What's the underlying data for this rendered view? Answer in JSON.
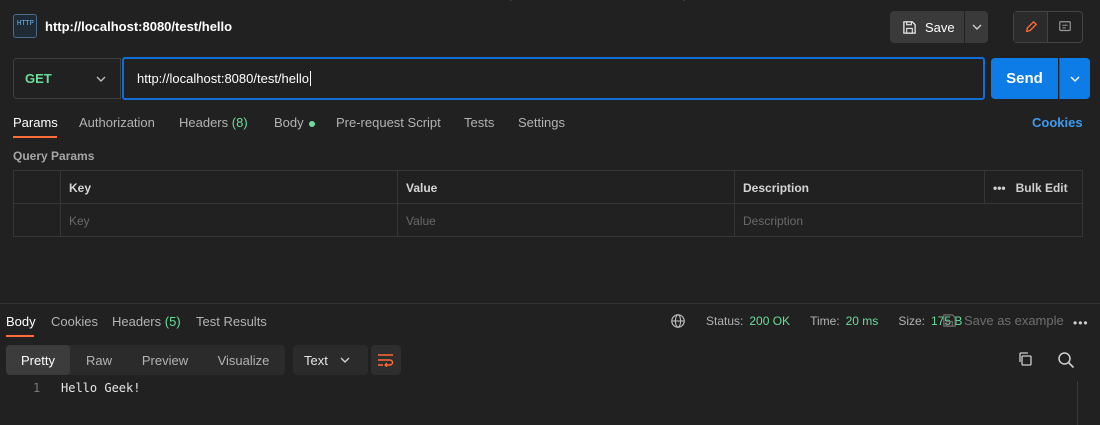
{
  "header": {
    "icon_label": "HTTP",
    "title": "http://localhost:8080/test/hello",
    "save_label": "Save"
  },
  "request": {
    "method": "GET",
    "url": "http://localhost:8080/test/hello",
    "send_label": "Send"
  },
  "request_tabs": {
    "params": "Params",
    "authorization": "Authorization",
    "headers": "Headers",
    "headers_count": "(8)",
    "body": "Body",
    "pre_request": "Pre-request Script",
    "tests": "Tests",
    "settings": "Settings",
    "cookies": "Cookies"
  },
  "query_params": {
    "section_label": "Query Params",
    "columns": {
      "key": "Key",
      "value": "Value",
      "description": "Description",
      "bulk_edit": "Bulk Edit"
    },
    "placeholders": {
      "key": "Key",
      "value": "Value",
      "description": "Description"
    }
  },
  "response_tabs": {
    "body": "Body",
    "cookies": "Cookies",
    "headers": "Headers",
    "headers_count": "(5)",
    "test_results": "Test Results"
  },
  "response_status": {
    "status_label": "Status:",
    "status_value": "200 OK",
    "time_label": "Time:",
    "time_value": "20 ms",
    "size_label": "Size:",
    "size_value": "175 B",
    "save_example": "Save as example"
  },
  "response_view": {
    "modes": [
      "Pretty",
      "Raw",
      "Preview",
      "Visualize"
    ],
    "format": "Text"
  },
  "response_body": {
    "lines": [
      {
        "num": "1",
        "text": "Hello Geek!"
      }
    ]
  },
  "colors": {
    "accent_orange": "#ff6c37",
    "send_blue": "#0d7ce6",
    "method_green": "#6bdd9a",
    "link_blue": "#3d9cf0"
  }
}
